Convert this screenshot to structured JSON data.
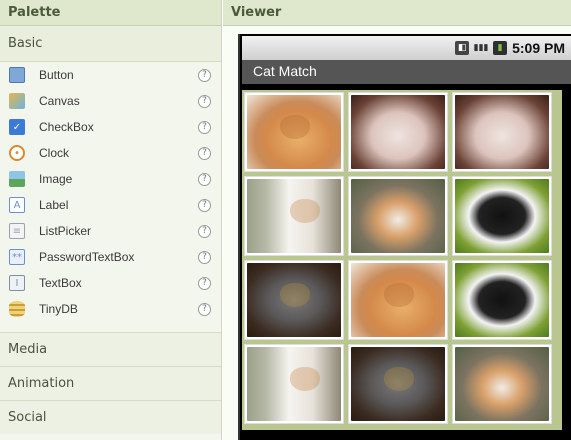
{
  "palette": {
    "title": "Palette",
    "active_category": "Basic",
    "components": [
      {
        "label": "Button",
        "icon": "button-icon",
        "color": "#7fa7d8"
      },
      {
        "label": "Canvas",
        "icon": "canvas-icon",
        "color": "#e3b84a"
      },
      {
        "label": "CheckBox",
        "icon": "checkbox-icon",
        "color": "#3b7ad6"
      },
      {
        "label": "Clock",
        "icon": "clock-icon",
        "color": "#d98a2b"
      },
      {
        "label": "Image",
        "icon": "image-icon",
        "color": "#5aa65a"
      },
      {
        "label": "Label",
        "icon": "label-icon",
        "color": "#6b8fc7"
      },
      {
        "label": "ListPicker",
        "icon": "listpicker-icon",
        "color": "#9aa3ad"
      },
      {
        "label": "PasswordTextBox",
        "icon": "passwordtextbox-icon",
        "color": "#6d8fc9"
      },
      {
        "label": "TextBox",
        "icon": "textbox-icon",
        "color": "#7e8fa6"
      },
      {
        "label": "TinyDB",
        "icon": "tinydb-icon",
        "color": "#d8b44a"
      }
    ],
    "help_glyph": "?",
    "other_categories": [
      "Media",
      "Animation",
      "Social"
    ]
  },
  "viewer": {
    "title": "Viewer",
    "status_time": "5:09 PM",
    "app_title": "Cat Match",
    "grid": [
      [
        "orange-sleeping-kitten",
        "white-fluffy-kitten",
        "white-fluffy-kitten"
      ],
      [
        "white-calico-kitten",
        "small-calico-kitten",
        "black-white-cat"
      ],
      [
        "gray-cat",
        "orange-sleeping-kitten",
        "black-white-cat"
      ],
      [
        "white-calico-kitten",
        "gray-cat",
        "small-calico-kitten"
      ]
    ]
  }
}
